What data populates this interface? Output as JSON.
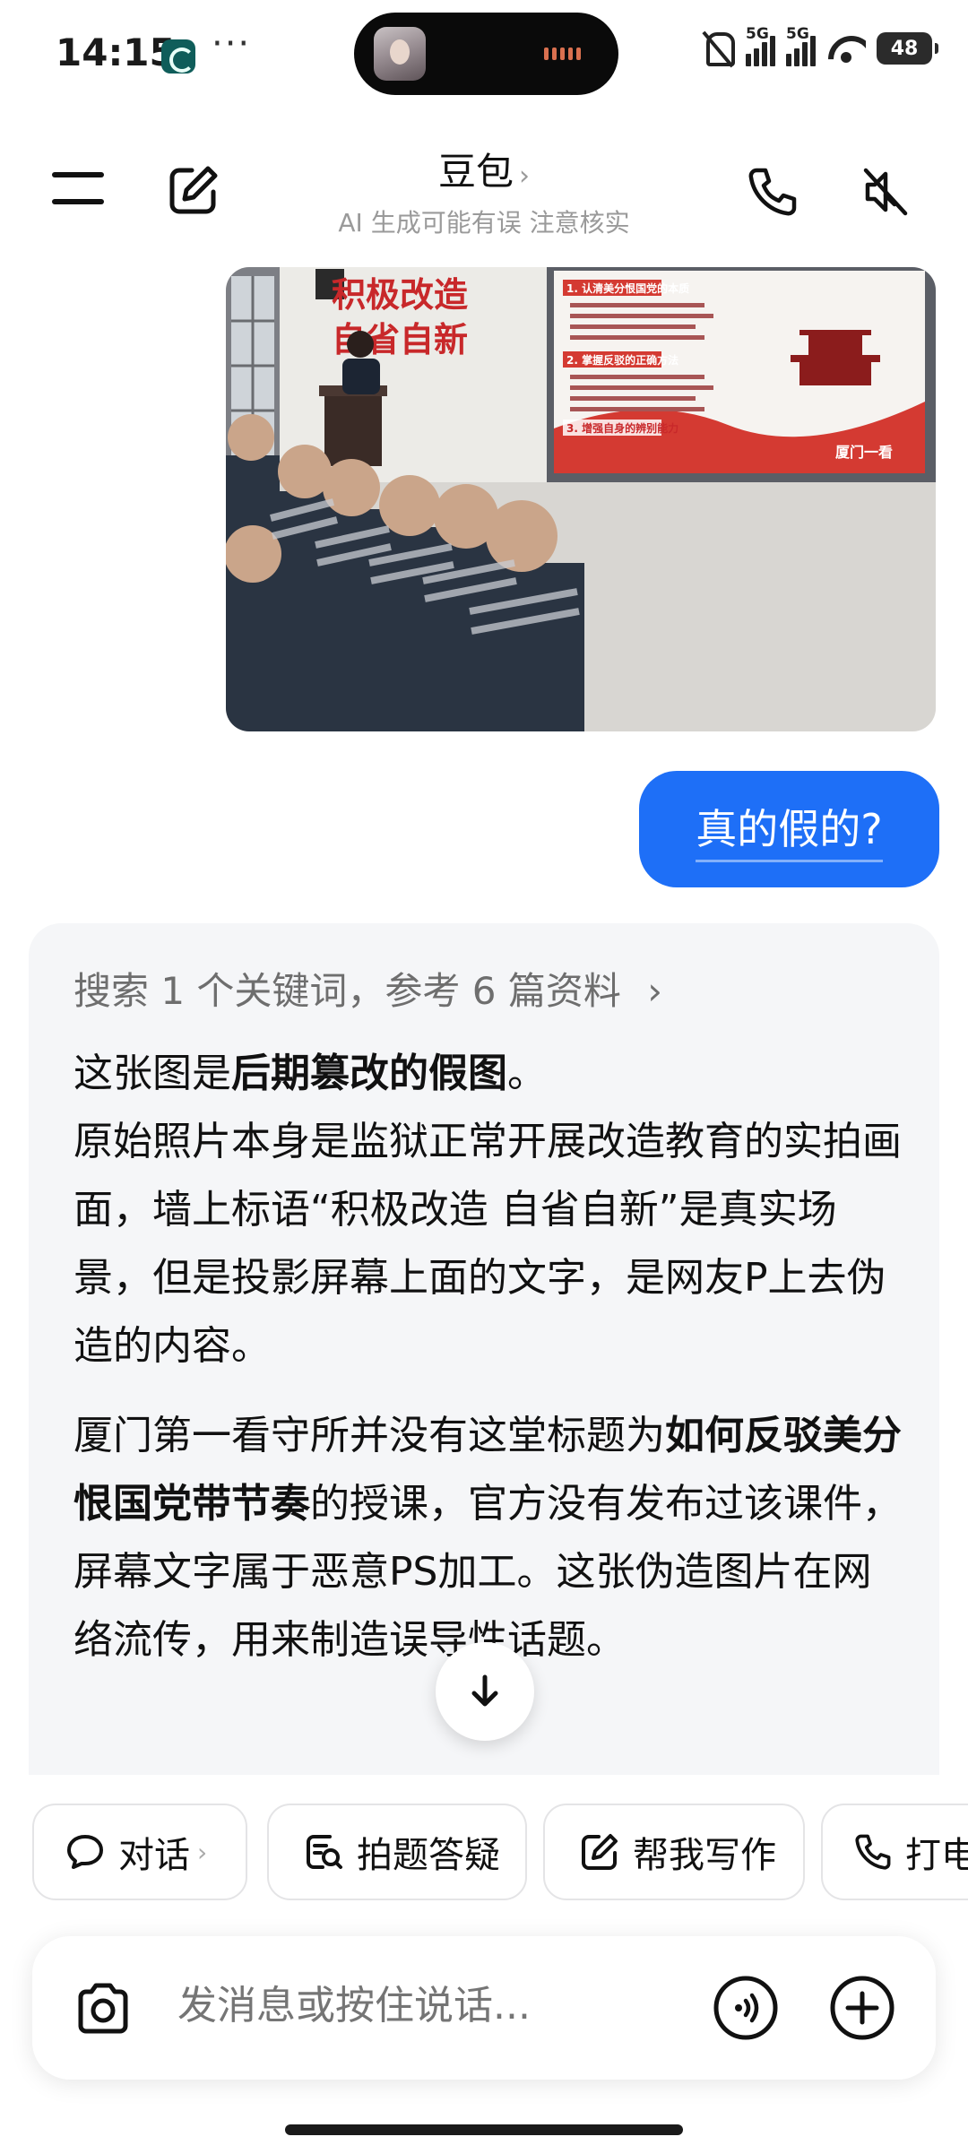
{
  "status_bar": {
    "time": "14:15",
    "dots": "···",
    "signal_label_1": "5G",
    "signal_label_2": "5G",
    "battery": "48"
  },
  "header": {
    "title": "豆包",
    "chevron": "›",
    "subtitle": "AI 生成可能有误 注意核实"
  },
  "shared_image": {
    "slogan_line_1": "积极改造",
    "slogan_line_2": "自省自新",
    "screen_heading_1": "1. 认清美分恨国党的本质",
    "screen_heading_2": "2. 掌握反驳的正确方法",
    "screen_heading_3": "3. 增强自身的辨别能力",
    "screen_caption": "厦门一看"
  },
  "user_message": "真的假的?",
  "answer": {
    "search_summary": "搜索 1 个关键词，参考 6 篇资料",
    "search_chevron": "›",
    "p1_a": "这张图是",
    "p1_bold": "后期篡改的假图",
    "p1_b": "。",
    "p1_c": "原始照片本身是监狱正常开展改造教育的实拍画面，墙上标语“积极改造 自省自新”是真实场景，但是投影屏幕上面的文字，是网友P上去伪造的内容。",
    "p2_a": "厦门第一看守所并没有这堂标题为",
    "p2_bold": "如何反驳美分恨国党带节奏",
    "p2_b": "的授课，官方没有发布过该课件，屏幕文字属于恶意PS加工。这张伪造图片在网络流传，用来制造误导性话题。"
  },
  "quick_actions": [
    {
      "label": "对话",
      "icon": "chat-bubble-icon"
    },
    {
      "label": "拍题答疑",
      "icon": "scan-question-icon"
    },
    {
      "label": "帮我写作",
      "icon": "edit-icon"
    },
    {
      "label": "打电话",
      "icon": "phone-icon"
    }
  ],
  "quick_chevron": "›",
  "input": {
    "placeholder": "发消息或按住说话..."
  },
  "colors": {
    "accent": "#1e6ff7",
    "card_bg": "#f5f6f8"
  }
}
